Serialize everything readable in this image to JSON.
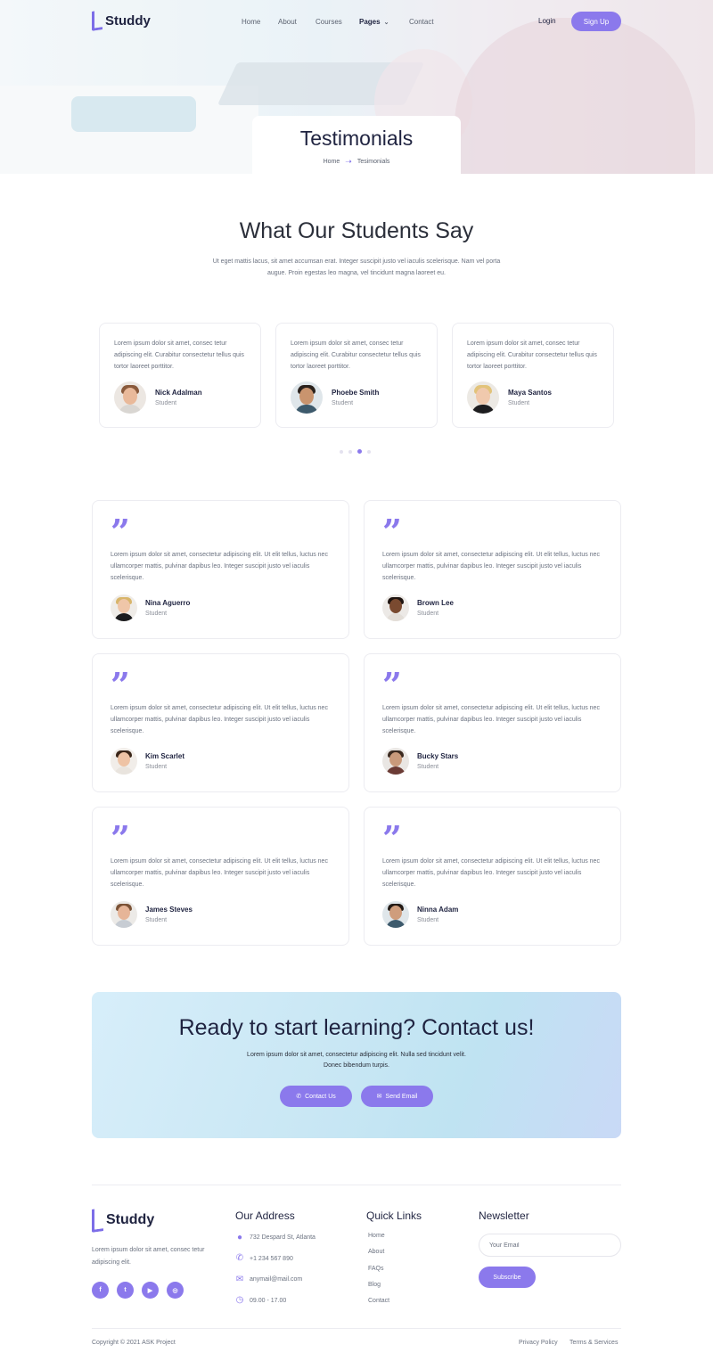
{
  "brand": {
    "name": "Studdy",
    "accent": "#8b79ec",
    "dark": "#1f2340"
  },
  "nav": {
    "items": [
      "Home",
      "About",
      "Courses",
      "Pages",
      "Contact"
    ],
    "active": "Pages",
    "login": "Login",
    "signup": "Sign Up"
  },
  "hero": {
    "title": "Testimonials",
    "breadcrumb": {
      "home": "Home",
      "current": "Tesimonials",
      "separator_icon": "arrow-right-icon"
    }
  },
  "students_section": {
    "title": "What Our Students Say",
    "subtitle": "Ut eget mattis lacus, sit amet accumsan erat. Integer suscipit justo vel iaculis scelerisque. Nam vel porta augue. Proin egestas leo magna, vel tincidunt magna laoreet eu."
  },
  "carousel": {
    "cards": [
      {
        "text": "Lorem ipsum dolor sit amet, consec tetur adipiscing elit. Curabitur consectetur tellus quis tortor laoreet porttitor.",
        "name": "Nick Adalman",
        "role": "Student"
      },
      {
        "text": "Lorem ipsum dolor sit amet, consec tetur adipiscing elit. Curabitur consectetur tellus quis tortor laoreet porttitor.",
        "name": "Phoebe Smith",
        "role": "Student"
      },
      {
        "text": "Lorem ipsum dolor sit amet, consec tetur adipiscing elit. Curabitur consectetur tellus quis tortor laoreet porttitor.",
        "name": "Maya Santos",
        "role": "Student"
      }
    ],
    "dots_total": 4,
    "active_dot": 3
  },
  "testimonials": [
    {
      "text": "Lorem ipsum dolor sit amet, consectetur adipiscing elit. Ut elit tellus, luctus nec ullamcorper mattis, pulvinar dapibus leo. Integer suscipit justo vel iaculis scelerisque.",
      "name": "Nina Aguerro",
      "role": "Student"
    },
    {
      "text": "Lorem ipsum dolor sit amet, consectetur adipiscing elit. Ut elit tellus, luctus nec ullamcorper mattis, pulvinar dapibus leo. Integer suscipit justo vel iaculis scelerisque.",
      "name": "Brown Lee",
      "role": "Student"
    },
    {
      "text": "Lorem ipsum dolor sit amet, consectetur adipiscing elit. Ut elit tellus, luctus nec ullamcorper mattis, pulvinar dapibus leo. Integer suscipit justo vel iaculis scelerisque.",
      "name": "Kim Scarlet",
      "role": "Student"
    },
    {
      "text": "Lorem ipsum dolor sit amet, consectetur adipiscing elit. Ut elit tellus, luctus nec ullamcorper mattis, pulvinar dapibus leo. Integer suscipit justo vel iaculis scelerisque.",
      "name": "Bucky Stars",
      "role": "Student"
    },
    {
      "text": "Lorem ipsum dolor sit amet, consectetur adipiscing elit. Ut elit tellus, luctus nec ullamcorper mattis, pulvinar dapibus leo. Integer suscipit justo vel iaculis scelerisque.",
      "name": "James Steves",
      "role": "Student"
    },
    {
      "text": "Lorem ipsum dolor sit amet, consectetur adipiscing elit. Ut elit tellus, luctus nec ullamcorper mattis, pulvinar dapibus leo. Integer suscipit justo vel iaculis scelerisque.",
      "name": "Ninna Adam",
      "role": "Student"
    }
  ],
  "cta": {
    "title": "Ready to start learning? Contact us!",
    "text": "Lorem ipsum dolor sit amet, consectetur adipiscing elit. Nulla sed tincidunt velit. Donec bibendum turpis.",
    "contact_button": "Contact Us",
    "email_button": "Send Email"
  },
  "footer": {
    "about": "Lorem ipsum dolor sit amet, consec tetur adipiscing elit.",
    "socials": [
      "facebook-icon",
      "twitter-icon",
      "youtube-icon",
      "instagram-icon"
    ],
    "address_heading": "Our Address",
    "address": "732 Despard St, Atlanta",
    "phone": "+1 234 567 890",
    "email": "anymail@mail.com",
    "hours": "09.00 - 17.00",
    "links_heading": "Quick Links",
    "links": [
      "Home",
      "About",
      "FAQs",
      "Blog",
      "Contact"
    ],
    "newsletter_heading": "Newsletter",
    "email_placeholder": "Your Email",
    "subscribe": "Subscribe",
    "copyright": "Copyright © 2021 ASK Project",
    "privacy": "Privacy Policy",
    "terms": "Terms & Services"
  }
}
